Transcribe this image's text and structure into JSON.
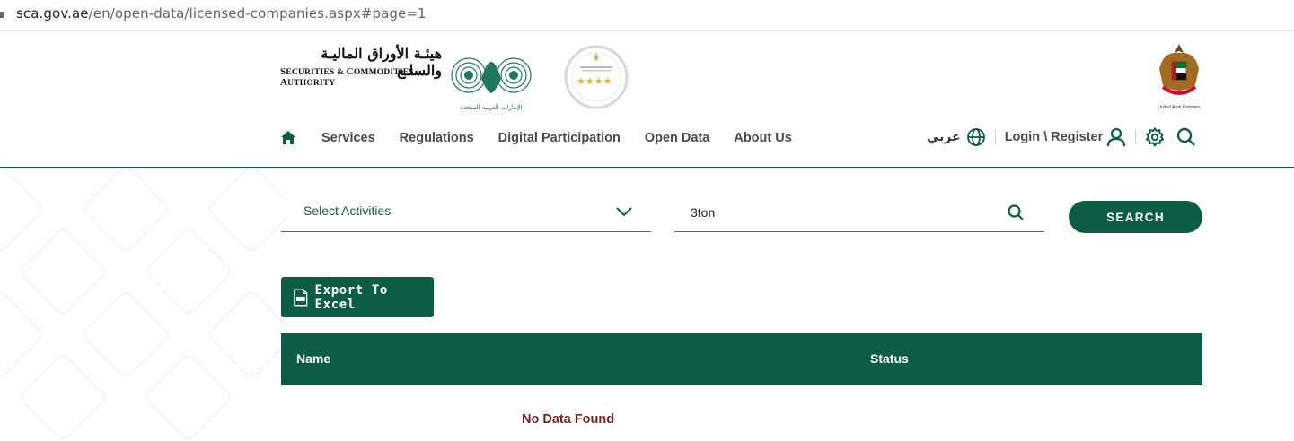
{
  "browser": {
    "url_host": "sca.gov.ae",
    "url_path": "/en/open-data/licensed-companies.aspx#page=1"
  },
  "header": {
    "logo_arabic": "هيئـة الأوراق الماليـة والسلـع",
    "logo_english": "Securities & Commodities Authority",
    "emblem_caption": "الإمارات العربية المتحدة",
    "uae_caption": "United Arab Emirates"
  },
  "nav": {
    "items": [
      {
        "label": "Services"
      },
      {
        "label": "Regulations"
      },
      {
        "label": "Digital Participation"
      },
      {
        "label": "Open Data"
      },
      {
        "label": "About Us"
      }
    ],
    "language_label": "عربي",
    "login_label": "Login \\ Register"
  },
  "filters": {
    "activities_label": "Select Activities",
    "search_value": "3ton",
    "search_button": "SEARCH"
  },
  "export": {
    "label": "Export To Excel"
  },
  "table": {
    "columns": [
      "Name",
      "Status"
    ],
    "empty_message": "No Data Found"
  },
  "colors": {
    "brand_green": "#0d5c46",
    "empty_text": "#7a1f1f"
  }
}
